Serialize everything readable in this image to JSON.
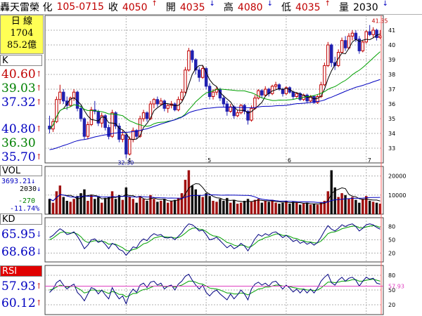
{
  "header": {
    "stock_name": "轟天雷榮  化",
    "date_code": "105-0715",
    "close_label": "收",
    "close_value": "4050",
    "close_arrow": "↑",
    "open_label": "開",
    "open_value": "4035",
    "open_arrow": "↓",
    "high_label": "高",
    "high_value": "4080",
    "high_arrow": "↓",
    "low_label": "低",
    "low_value": "4035",
    "low_arrow": "↑",
    "volume_label": "量",
    "volume_value": "2030",
    "volume_arrow": "↓"
  },
  "left_panel": {
    "daily_title": "日  線",
    "daily_count": "1704",
    "daily_amount": "85.2億",
    "k_tab": "K",
    "k_values": [
      {
        "text": "40.60",
        "arrow": "↑",
        "color": "#c00000"
      },
      {
        "text": "39.03",
        "arrow": "↑",
        "color": "#008000"
      },
      {
        "text": "37.32",
        "arrow": "↑",
        "color": "#0000c0"
      },
      {
        "text": "40.80",
        "arrow": "↑",
        "color": "#0000c0"
      },
      {
        "text": "36.30",
        "arrow": "",
        "color": "#008000"
      },
      {
        "text": "35.70",
        "arrow": "↑",
        "color": "#0000c0"
      }
    ],
    "vol_tab": "VOL",
    "vol_values": [
      {
        "text": "3693.21",
        "arrow": "↓",
        "color": "#0000c0"
      },
      {
        "text": "2030",
        "arrow": "↓",
        "color": "#000000"
      },
      {
        "text": "-270",
        "arrow": "",
        "color": "#008000"
      },
      {
        "text": "-11.74%",
        "arrow": "",
        "color": "#0000c0"
      }
    ],
    "kd_tab": "KD",
    "kd_values": [
      {
        "text": "65.95",
        "arrow": "↓",
        "color": "#0000c0"
      },
      {
        "text": "68.68",
        "arrow": "↓",
        "color": "#0000c0"
      }
    ],
    "rsi_tab": "RSI",
    "rsi_values": [
      {
        "text": "57.93",
        "arrow": "↑",
        "color": "#0000c0"
      },
      {
        "text": "60.12",
        "arrow": "↑",
        "color": "#0000c0"
      }
    ]
  },
  "colors": {
    "up": "#c00000",
    "down": "#2020b0",
    "ma_short": "#000000",
    "ma_mid": "#00a000",
    "ma_long": "#0000c0",
    "grid": "#b0b0b0"
  },
  "chart_data": [
    {
      "type": "candlestick",
      "name": "price",
      "ylim": [
        32,
        42
      ],
      "yticks": [
        33,
        34,
        35,
        36,
        37,
        38,
        39,
        40,
        41
      ],
      "month_labels": [
        {
          "label": "4",
          "index": 22
        },
        {
          "label": "5",
          "index": 45
        },
        {
          "label": "6",
          "index": 68
        },
        {
          "label": "7",
          "index": 91
        }
      ],
      "annotations": [
        {
          "text": "41.35",
          "index": 95,
          "value": 41.35
        },
        {
          "text": "32.30",
          "index": 22,
          "value": 32.3
        }
      ],
      "ohlc": [
        [
          34.5,
          35.2,
          34.0,
          34.3
        ],
        [
          34.3,
          35.0,
          34.1,
          34.8
        ],
        [
          34.8,
          36.5,
          34.7,
          36.3
        ],
        [
          36.3,
          37.3,
          36.0,
          36.8
        ],
        [
          36.8,
          37.0,
          36.0,
          36.2
        ],
        [
          36.2,
          36.5,
          35.6,
          35.9
        ],
        [
          35.9,
          36.5,
          35.8,
          36.4
        ],
        [
          36.4,
          37.0,
          36.2,
          36.8
        ],
        [
          36.8,
          36.9,
          35.5,
          35.7
        ],
        [
          35.7,
          35.9,
          34.8,
          35.0
        ],
        [
          35.0,
          35.1,
          33.6,
          33.8
        ],
        [
          33.8,
          34.8,
          33.6,
          34.6
        ],
        [
          34.6,
          35.8,
          34.5,
          35.6
        ],
        [
          35.6,
          36.2,
          35.3,
          35.5
        ],
        [
          35.5,
          35.6,
          34.5,
          34.7
        ],
        [
          34.7,
          35.4,
          34.4,
          35.2
        ],
        [
          35.2,
          35.3,
          34.2,
          34.4
        ],
        [
          34.4,
          34.6,
          33.6,
          33.8
        ],
        [
          33.8,
          35.6,
          33.7,
          35.4
        ],
        [
          35.4,
          35.5,
          34.3,
          34.5
        ],
        [
          34.5,
          34.7,
          33.4,
          33.6
        ],
        [
          33.6,
          34.2,
          33.4,
          33.9
        ],
        [
          33.9,
          34.0,
          32.3,
          32.6
        ],
        [
          32.6,
          33.8,
          32.5,
          33.6
        ],
        [
          33.6,
          34.4,
          33.4,
          34.2
        ],
        [
          34.2,
          34.3,
          33.6,
          33.8
        ],
        [
          33.8,
          35.2,
          33.7,
          35.0
        ],
        [
          35.0,
          35.6,
          34.8,
          35.4
        ],
        [
          35.4,
          35.5,
          34.8,
          35.0
        ],
        [
          35.0,
          36.2,
          34.9,
          36.0
        ],
        [
          36.0,
          36.4,
          35.7,
          36.3
        ],
        [
          36.3,
          36.5,
          35.8,
          36.0
        ],
        [
          36.0,
          36.4,
          35.9,
          36.2
        ],
        [
          36.2,
          36.3,
          35.5,
          35.7
        ],
        [
          35.7,
          36.0,
          35.4,
          35.9
        ],
        [
          35.9,
          36.2,
          35.7,
          36.0
        ],
        [
          36.0,
          36.1,
          35.5,
          35.6
        ],
        [
          35.6,
          36.5,
          35.5,
          36.3
        ],
        [
          36.3,
          37.0,
          36.2,
          36.8
        ],
        [
          36.8,
          38.5,
          36.7,
          38.3
        ],
        [
          38.3,
          39.8,
          38.2,
          39.6
        ],
        [
          39.6,
          39.7,
          38.8,
          39.0
        ],
        [
          39.0,
          39.1,
          38.0,
          38.3
        ],
        [
          38.3,
          38.5,
          37.5,
          37.8
        ],
        [
          37.8,
          38.6,
          37.7,
          38.4
        ],
        [
          38.4,
          38.5,
          37.0,
          37.2
        ],
        [
          37.2,
          37.4,
          36.3,
          36.5
        ],
        [
          36.5,
          37.0,
          36.3,
          36.8
        ],
        [
          36.8,
          37.2,
          36.6,
          37.0
        ],
        [
          37.0,
          37.1,
          36.2,
          36.4
        ],
        [
          36.4,
          36.6,
          35.8,
          36.0
        ],
        [
          36.0,
          36.2,
          35.2,
          35.5
        ],
        [
          35.5,
          36.0,
          35.4,
          35.8
        ],
        [
          35.8,
          35.9,
          35.0,
          35.2
        ],
        [
          35.2,
          35.6,
          35.1,
          35.4
        ],
        [
          35.4,
          36.0,
          35.3,
          35.9
        ],
        [
          35.9,
          36.0,
          35.3,
          35.5
        ],
        [
          35.5,
          35.6,
          34.6,
          34.9
        ],
        [
          34.9,
          35.9,
          34.8,
          35.7
        ],
        [
          35.7,
          36.6,
          35.6,
          36.4
        ],
        [
          36.4,
          37.0,
          36.3,
          36.9
        ],
        [
          36.9,
          37.0,
          36.4,
          36.6
        ],
        [
          36.6,
          37.2,
          36.5,
          37.0
        ],
        [
          37.0,
          37.1,
          36.5,
          36.7
        ],
        [
          36.7,
          37.3,
          36.6,
          37.2
        ],
        [
          37.2,
          37.5,
          37.0,
          37.3
        ],
        [
          37.3,
          37.4,
          36.9,
          37.0
        ],
        [
          37.0,
          37.1,
          36.5,
          36.7
        ],
        [
          36.7,
          37.2,
          36.6,
          37.1
        ],
        [
          37.1,
          37.2,
          36.7,
          36.8
        ],
        [
          36.8,
          36.9,
          36.3,
          36.5
        ],
        [
          36.5,
          36.8,
          36.4,
          36.7
        ],
        [
          36.7,
          36.8,
          36.2,
          36.3
        ],
        [
          36.3,
          36.7,
          36.2,
          36.6
        ],
        [
          36.6,
          36.7,
          36.1,
          36.2
        ],
        [
          36.2,
          36.6,
          36.1,
          36.5
        ],
        [
          36.5,
          36.6,
          36.0,
          36.1
        ],
        [
          36.1,
          36.6,
          36.0,
          36.5
        ],
        [
          36.5,
          37.5,
          36.4,
          37.3
        ],
        [
          37.3,
          38.8,
          37.2,
          38.6
        ],
        [
          38.6,
          40.2,
          38.5,
          40.0
        ],
        [
          40.0,
          40.1,
          38.5,
          38.8
        ],
        [
          38.8,
          39.2,
          38.3,
          38.6
        ],
        [
          38.6,
          39.7,
          38.5,
          39.5
        ],
        [
          39.5,
          40.5,
          39.4,
          40.3
        ],
        [
          40.3,
          40.6,
          39.6,
          39.8
        ],
        [
          39.8,
          40.8,
          39.7,
          40.6
        ],
        [
          40.6,
          41.0,
          40.3,
          40.8
        ],
        [
          40.8,
          41.0,
          40.2,
          40.4
        ],
        [
          40.4,
          40.6,
          39.4,
          39.6
        ],
        [
          39.6,
          40.3,
          39.5,
          40.2
        ],
        [
          40.2,
          41.0,
          40.1,
          40.9
        ],
        [
          40.9,
          41.35,
          40.6,
          40.7
        ],
        [
          40.7,
          41.2,
          40.5,
          41.0
        ],
        [
          41.0,
          41.1,
          40.3,
          40.5
        ],
        [
          40.5,
          41.0,
          40.4,
          40.6
        ]
      ]
    },
    {
      "type": "bar",
      "name": "volume",
      "ylim": [
        0,
        25000
      ],
      "yticks": [
        10000,
        20000
      ],
      "values": [
        8000,
        6000,
        12000,
        15000,
        9000,
        7000,
        6500,
        8000,
        9500,
        11000,
        13000,
        7000,
        10000,
        8000,
        9000,
        6000,
        8500,
        9000,
        12000,
        8000,
        10000,
        7500,
        14000,
        9000,
        8000,
        6000,
        9500,
        8000,
        7000,
        10000,
        8000,
        6500,
        7000,
        8000,
        6000,
        7000,
        7500,
        8500,
        11000,
        18000,
        23000,
        15000,
        13000,
        10000,
        9000,
        11000,
        9500,
        7000,
        6500,
        8000,
        7000,
        8500,
        6000,
        7500,
        5500,
        6000,
        7000,
        8000,
        6500,
        7500,
        8000,
        6000,
        7000,
        6500,
        7500,
        6000,
        5500,
        6000,
        7000,
        5500,
        6500,
        6000,
        5000,
        5500,
        6000,
        5000,
        5500,
        5000,
        6000,
        7000,
        12000,
        23000,
        14000,
        9000,
        11000,
        10000,
        8000,
        9000,
        7500,
        6000,
        8000,
        9500,
        7000,
        6500,
        6000,
        5500
      ],
      "up_flags": [
        0,
        1,
        1,
        1,
        0,
        0,
        1,
        1,
        0,
        0,
        0,
        1,
        1,
        0,
        0,
        1,
        0,
        0,
        1,
        0,
        0,
        1,
        0,
        1,
        1,
        0,
        1,
        1,
        0,
        1,
        1,
        0,
        1,
        0,
        1,
        1,
        0,
        1,
        1,
        1,
        1,
        0,
        0,
        0,
        1,
        0,
        0,
        1,
        1,
        0,
        0,
        0,
        1,
        0,
        1,
        1,
        0,
        0,
        1,
        1,
        1,
        0,
        1,
        0,
        1,
        1,
        0,
        0,
        1,
        0,
        0,
        1,
        0,
        1,
        0,
        1,
        0,
        1,
        1,
        1,
        1,
        0,
        0,
        1,
        1,
        0,
        1,
        1,
        0,
        0,
        1,
        1,
        0,
        1,
        0,
        1
      ]
    },
    {
      "type": "line",
      "name": "kd",
      "ylim": [
        0,
        100
      ],
      "yticks": [
        20,
        50,
        80
      ],
      "series_k": [
        55,
        60,
        68,
        75,
        70,
        62,
        64,
        68,
        58,
        45,
        30,
        38,
        50,
        52,
        44,
        48,
        40,
        30,
        42,
        38,
        28,
        25,
        15,
        24,
        34,
        32,
        45,
        52,
        48,
        58,
        64,
        60,
        62,
        55,
        54,
        56,
        50,
        58,
        66,
        78,
        86,
        84,
        78,
        70,
        72,
        62,
        50,
        52,
        56,
        48,
        40,
        32,
        38,
        30,
        34,
        42,
        36,
        25,
        38,
        52,
        62,
        58,
        64,
        60,
        66,
        68,
        62,
        55,
        60,
        54,
        46,
        50,
        42,
        46,
        40,
        44,
        38,
        44,
        56,
        70,
        82,
        74,
        70,
        76,
        84,
        80,
        84,
        86,
        80,
        70,
        76,
        84,
        86,
        84,
        78,
        74
      ],
      "series_d": [
        50,
        54,
        60,
        66,
        68,
        66,
        65,
        66,
        63,
        57,
        48,
        44,
        46,
        48,
        47,
        47,
        45,
        40,
        41,
        40,
        36,
        32,
        26,
        25,
        28,
        30,
        35,
        41,
        43,
        48,
        54,
        56,
        58,
        57,
        56,
        56,
        54,
        55,
        59,
        65,
        72,
        76,
        77,
        74,
        73,
        69,
        63,
        59,
        58,
        55,
        50,
        44,
        42,
        38,
        36,
        38,
        37,
        33,
        35,
        41,
        48,
        51,
        55,
        57,
        60,
        63,
        63,
        60,
        60,
        58,
        54,
        53,
        49,
        48,
        45,
        45,
        43,
        43,
        47,
        55,
        64,
        67,
        68,
        71,
        75,
        77,
        79,
        81,
        81,
        77,
        77,
        79,
        81,
        82,
        81,
        78
      ]
    },
    {
      "type": "line",
      "name": "rsi",
      "ylim": [
        0,
        100
      ],
      "yticks": [
        20,
        50,
        80
      ],
      "reference_label": "57.93",
      "reference_value": 57.93,
      "series_fast": [
        45,
        52,
        65,
        70,
        60,
        52,
        58,
        62,
        45,
        38,
        28,
        42,
        55,
        52,
        42,
        50,
        40,
        32,
        55,
        42,
        32,
        38,
        22,
        42,
        52,
        45,
        60,
        64,
        55,
        66,
        68,
        60,
        64,
        52,
        58,
        60,
        50,
        62,
        68,
        78,
        82,
        70,
        60,
        52,
        60,
        45,
        38,
        46,
        50,
        42,
        36,
        30,
        42,
        32,
        40,
        50,
        42,
        30,
        52,
        62,
        66,
        60,
        64,
        58,
        66,
        68,
        60,
        52,
        60,
        54,
        46,
        52,
        44,
        52,
        44,
        52,
        44,
        54,
        68,
        76,
        82,
        65,
        60,
        70,
        76,
        68,
        74,
        76,
        70,
        58,
        68,
        76,
        72,
        74,
        64,
        62
      ],
      "series_slow": [
        50,
        52,
        56,
        60,
        58,
        56,
        57,
        58,
        54,
        50,
        44,
        46,
        50,
        50,
        48,
        49,
        46,
        43,
        47,
        45,
        41,
        41,
        36,
        39,
        43,
        43,
        48,
        51,
        52,
        55,
        58,
        58,
        59,
        57,
        57,
        58,
        56,
        58,
        60,
        64,
        68,
        68,
        66,
        63,
        62,
        58,
        54,
        53,
        52,
        50,
        47,
        44,
        44,
        42,
        42,
        44,
        43,
        40,
        44,
        48,
        52,
        53,
        56,
        56,
        58,
        60,
        60,
        58,
        58,
        57,
        55,
        54,
        52,
        52,
        50,
        50,
        49,
        50,
        54,
        60,
        66,
        66,
        65,
        66,
        68,
        68,
        69,
        71,
        71,
        68,
        68,
        70,
        71,
        72,
        70,
        68
      ]
    }
  ]
}
